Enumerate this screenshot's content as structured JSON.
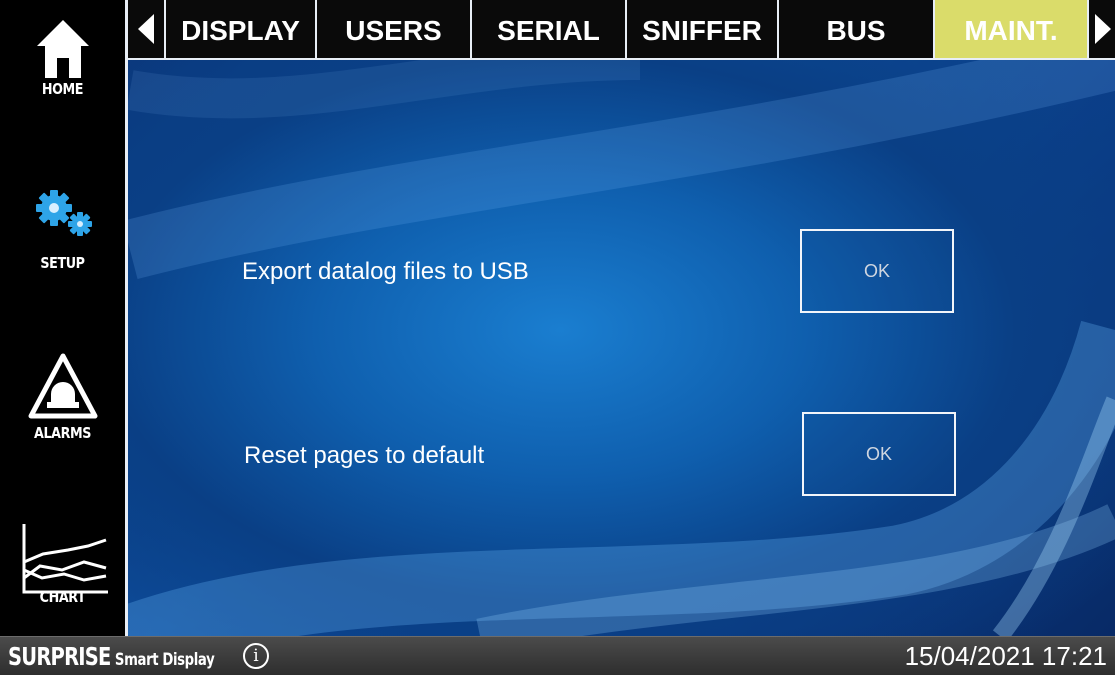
{
  "sidebar": {
    "home_label": "HOME",
    "setup_label": "SETUP",
    "alarms_label": "ALARMS",
    "chart_label": "CHART"
  },
  "tabs": {
    "items": [
      {
        "label": "DISPLAY"
      },
      {
        "label": "USERS"
      },
      {
        "label": "SERIAL"
      },
      {
        "label": "SNIFFER"
      },
      {
        "label": "BUS"
      },
      {
        "label": "MAINT."
      }
    ],
    "active_index": 5,
    "active_color": "#dadc6a"
  },
  "main": {
    "export_label": "Export datalog files to USB",
    "export_button": "OK",
    "reset_label": "Reset pages to default",
    "reset_button": "OK"
  },
  "footer": {
    "brand_main": "SURPRISE",
    "brand_sub": "Smart Display",
    "info_symbol": "i",
    "datetime": "15/04/2021 17:21"
  }
}
